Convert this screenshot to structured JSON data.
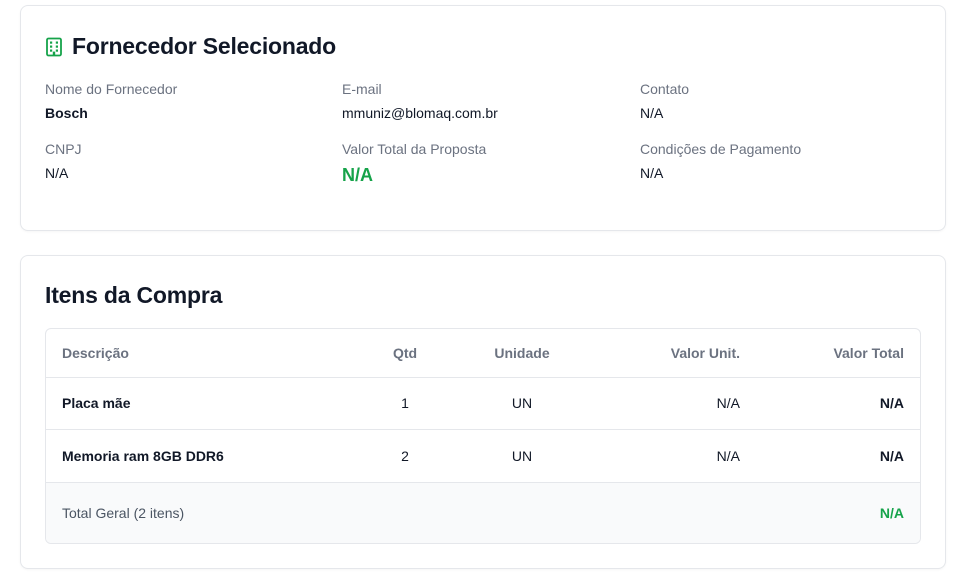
{
  "supplier_card": {
    "title": "Fornecedor Selecionado",
    "icon": "building-icon",
    "fields": {
      "name": {
        "label": "Nome do Fornecedor",
        "value": "Bosch"
      },
      "email": {
        "label": "E-mail",
        "value": "mmuniz@blomaq.com.br"
      },
      "contact": {
        "label": "Contato",
        "value": "N/A"
      },
      "cnpj": {
        "label": "CNPJ",
        "value": "N/A"
      },
      "total_proposal": {
        "label": "Valor Total da Proposta",
        "value": "N/A"
      },
      "payment_terms": {
        "label": "Condições de Pagamento",
        "value": "N/A"
      }
    }
  },
  "items_card": {
    "title": "Itens da Compra",
    "columns": {
      "description": "Descrição",
      "qty": "Qtd",
      "unit": "Unidade",
      "unit_price": "Valor Unit.",
      "total": "Valor Total"
    },
    "rows": [
      {
        "description": "Placa mãe",
        "qty": "1",
        "unit": "UN",
        "unit_price": "N/A",
        "total": "N/A"
      },
      {
        "description": "Memoria ram 8GB DDR6",
        "qty": "2",
        "unit": "UN",
        "unit_price": "N/A",
        "total": "N/A"
      }
    ],
    "footer": {
      "label": "Total Geral (2 itens)",
      "value": "N/A"
    }
  },
  "colors": {
    "accent_green": "#16a34a",
    "border": "#e5e7eb",
    "muted_text": "#6b7280"
  }
}
